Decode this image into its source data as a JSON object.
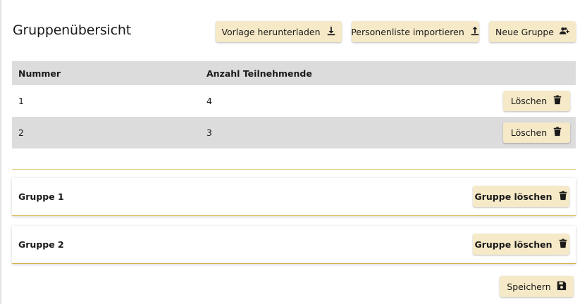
{
  "header": {
    "title": "Gruppenübersicht",
    "download_template_label": "Vorlage herunterladen",
    "import_list_label": "Personenliste importieren",
    "new_group_label": "Neue Gruppe"
  },
  "table": {
    "columns": [
      "Nummer",
      "Anzahl Teilnehmende"
    ],
    "rows": [
      {
        "number": "1",
        "count": "4",
        "delete_label": "Löschen"
      },
      {
        "number": "2",
        "count": "3",
        "delete_label": "Löschen"
      }
    ]
  },
  "groups": [
    {
      "name": "Gruppe 1",
      "delete_label": "Gruppe löschen"
    },
    {
      "name": "Gruppe 2",
      "delete_label": "Gruppe löschen"
    }
  ],
  "footer": {
    "save_label": "Speichern"
  },
  "colors": {
    "button_bg": "#f5e9c7",
    "accent_line": "#e0c45e",
    "row_alt": "#dcdcdc"
  }
}
